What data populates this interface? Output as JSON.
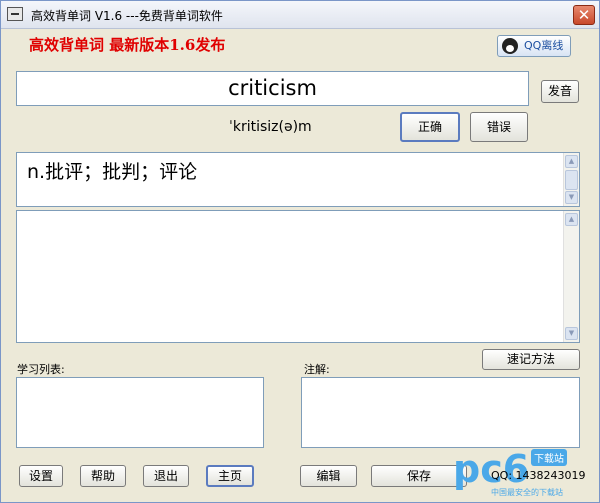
{
  "window": {
    "title": "高效背单词 V1.6  ---免费背单词软件",
    "close_glyph": "✕"
  },
  "headline": "高效背单词  最新版本1.6发布",
  "qq_button": {
    "label": "QQ离线"
  },
  "word": {
    "value": "criticism",
    "phonetic": "ˈkritisiz(ə)m",
    "pronounce_label": "发音",
    "correct_label": "正确",
    "wrong_label": "错误"
  },
  "definition": "n.批评；批判；评论",
  "example_text": "",
  "study_list": {
    "label": "学习列表:"
  },
  "notes": {
    "label": "注解:",
    "mnemonic_label": "速记方法"
  },
  "bottom_buttons": {
    "settings": "设置",
    "help": "帮助",
    "exit": "退出",
    "home": "主页",
    "edit": "编辑",
    "save": "保存"
  },
  "footer": {
    "qq_number": "QQ: 1438243019"
  },
  "watermark": {
    "brand": "pc6",
    "badge": "下载站",
    "tagline": "中国最安全的下载站"
  },
  "colors": {
    "headline": "#e00000",
    "window_bg": "#ece9d8",
    "border": "#7f9db9"
  }
}
